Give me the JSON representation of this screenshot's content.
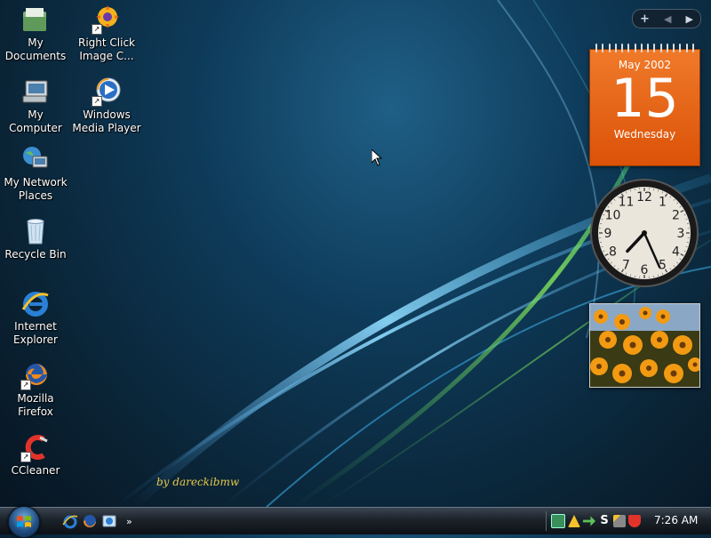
{
  "desktop": {
    "icons": [
      {
        "label": "My\nDocuments",
        "icon": "folder-documents-icon"
      },
      {
        "label": "Right Click\nImage C...",
        "icon": "gear-image-icon"
      },
      {
        "label": "My Computer",
        "icon": "computer-icon"
      },
      {
        "label": "Windows\nMedia Player",
        "icon": "media-player-icon"
      },
      {
        "label": "My Network\nPlaces",
        "icon": "network-globe-icon"
      },
      {
        "label": "Recycle Bin",
        "icon": "recycle-bin-icon"
      },
      {
        "label": "Internet\nExplorer",
        "icon": "internet-explorer-icon"
      },
      {
        "label": "Mozilla Firefox",
        "icon": "firefox-icon"
      },
      {
        "label": "CCleaner",
        "icon": "ccleaner-icon"
      }
    ],
    "signature": "by dareckibmw"
  },
  "sidebar": {
    "controls": {
      "add": "+",
      "prev": "◀",
      "next": "▶"
    },
    "calendar": {
      "month": "May 2002",
      "day": "15",
      "weekday": "Wednesday"
    },
    "clock": {
      "hour": 7,
      "minute": 26,
      "numerals": [
        "12",
        "1",
        "2",
        "3",
        "4",
        "5",
        "6",
        "7",
        "8",
        "9",
        "10",
        "11"
      ]
    }
  },
  "taskbar": {
    "start": "start-orb-windows-icon",
    "quicklaunch": [
      "internet-explorer-icon",
      "firefox-icon",
      "show-desktop-icon"
    ],
    "chevron": "»",
    "tray_icons": [
      "network-icon",
      "warning-icon",
      "green-arrow-icon",
      "s-icon",
      "wand-icon",
      "shield-icon"
    ],
    "time": "7:26 AM"
  },
  "colors": {
    "calendar": "#e8620f",
    "taskbar": "#1b222a",
    "signature": "#e6c84a"
  }
}
